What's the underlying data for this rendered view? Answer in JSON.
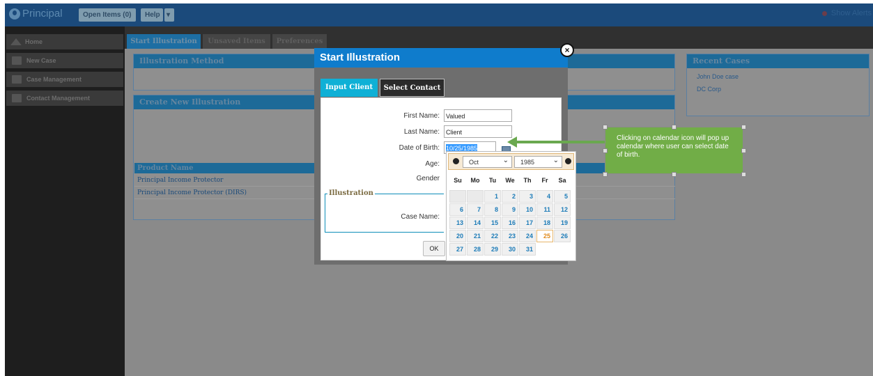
{
  "topbar": {
    "logo": "Principal",
    "open_items": "Open Items (0)",
    "help": "Help",
    "help_caret": "▾",
    "alerts": "Show Alerts"
  },
  "nav": {
    "items": [
      {
        "label": "Home"
      },
      {
        "label": "New Case"
      },
      {
        "label": "Case Management"
      },
      {
        "label": "Contact Management"
      }
    ]
  },
  "tabs": [
    {
      "label": "Start Illustration"
    },
    {
      "label": "Unsaved Items"
    },
    {
      "label": "Preferences"
    }
  ],
  "panels": {
    "method": "Illustration Method",
    "create": "Create New Illustration",
    "recent": "Recent Cases",
    "recent_items": [
      "John Doe case",
      "DC Corp"
    ],
    "grid_header": "Product Name",
    "grid_rows": [
      "Principal Income Protector",
      "Principal Income Protector (DIRS)"
    ]
  },
  "modal": {
    "title": "Start Illustration",
    "close": "×",
    "tab_input": "Input Client",
    "tab_select": "Select Contact",
    "first_name_label": "First Name:",
    "first_name": "Valued",
    "last_name_label": "Last Name:",
    "last_name": "Client",
    "dob_label": "Date of Birth:",
    "dob": "10/25/1985",
    "age_label": "Age:",
    "gender_label": "Gender",
    "legend": "Illustration",
    "case_name_label": "Case Name:",
    "ok": "OK"
  },
  "calendar": {
    "month": "Oct",
    "year": "1985",
    "weekdays": [
      "Su",
      "Mo",
      "Tu",
      "We",
      "Th",
      "Fr",
      "Sa"
    ],
    "selected_day": "25",
    "weeks": [
      [
        "",
        "",
        "1",
        "2",
        "3",
        "4",
        "5"
      ],
      [
        "6",
        "7",
        "8",
        "9",
        "10",
        "11",
        "12"
      ],
      [
        "13",
        "14",
        "15",
        "16",
        "17",
        "18",
        "19"
      ],
      [
        "20",
        "21",
        "22",
        "23",
        "24",
        "25",
        "26"
      ],
      [
        "27",
        "28",
        "29",
        "30",
        "31",
        "",
        ""
      ]
    ]
  },
  "callout": {
    "text": "Clicking on calendar icon will pop up calendar where user can select date of birth.",
    "color": "#71ad47"
  }
}
